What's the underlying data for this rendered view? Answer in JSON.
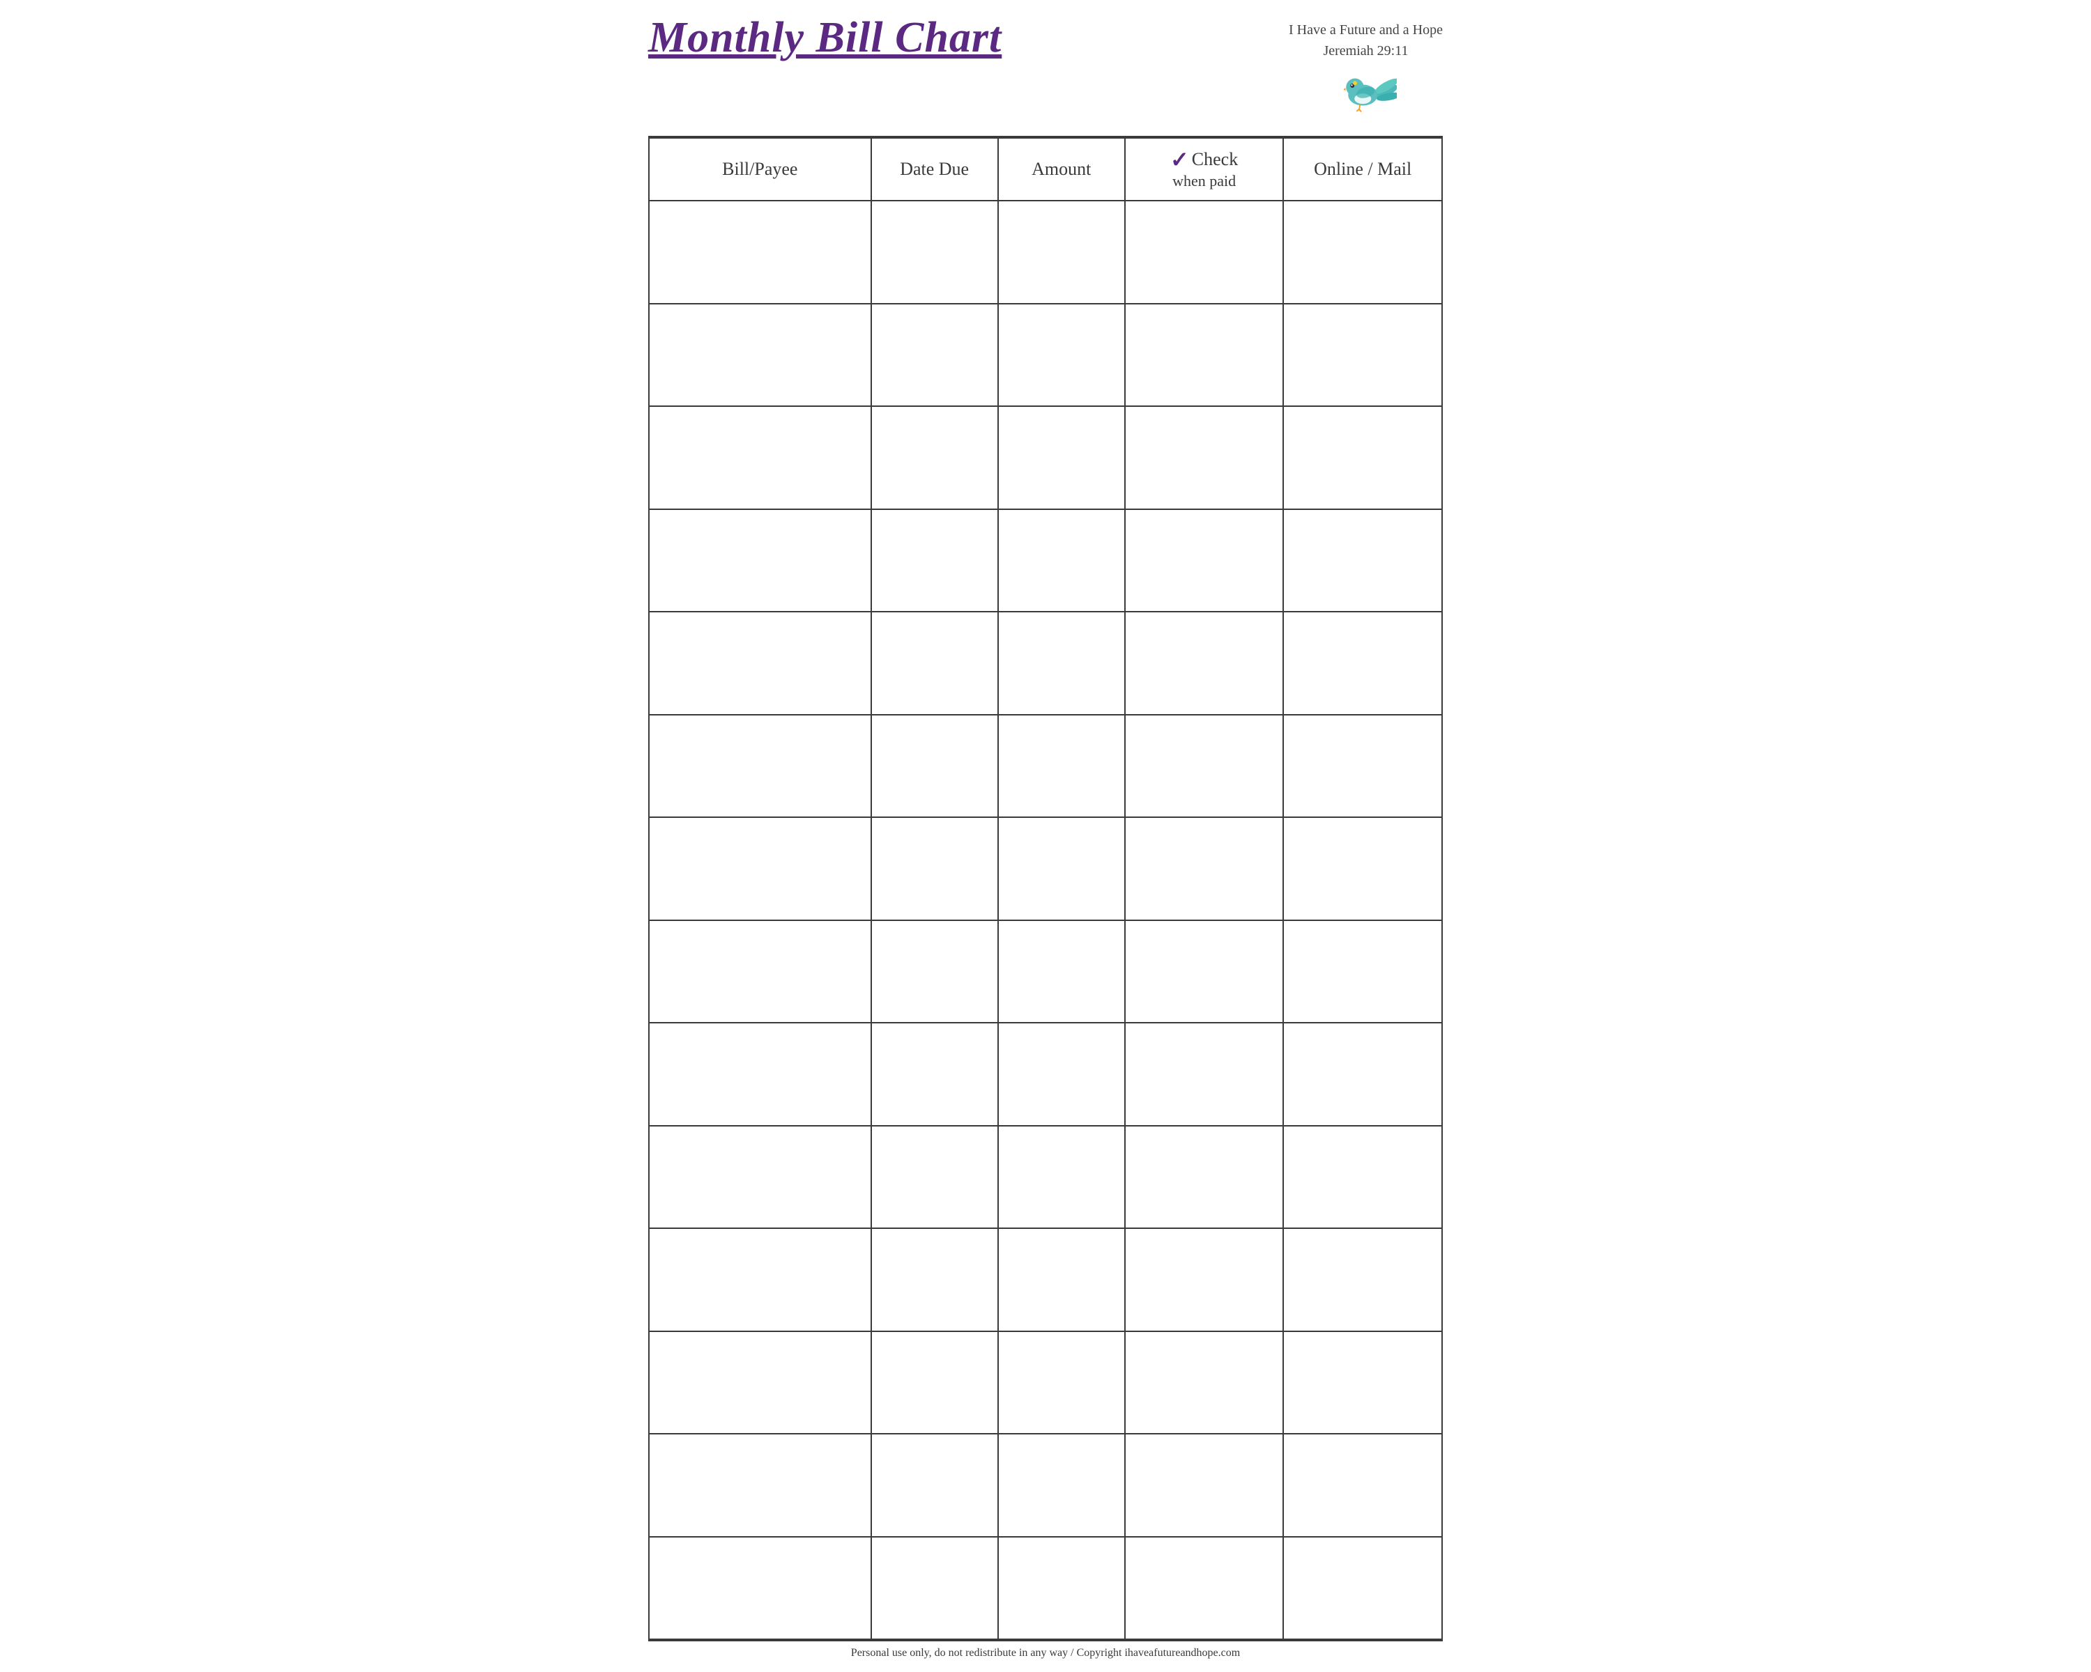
{
  "header": {
    "title": "Monthly Bill Chart",
    "scripture_line1": "I Have a Future and a Hope",
    "scripture_line2": "Jeremiah 29:11"
  },
  "table": {
    "columns": [
      {
        "key": "payee",
        "label": "Bill/Payee"
      },
      {
        "key": "date",
        "label": "Date Due"
      },
      {
        "key": "amount",
        "label": "Amount"
      },
      {
        "key": "check",
        "label": "Check",
        "sublabel": "when paid"
      },
      {
        "key": "online",
        "label": "Online / Mail"
      }
    ],
    "row_count": 14
  },
  "footer": {
    "text": "Personal use only, do not redistribute in any way / Copyright ihaveafutureandhope.com"
  },
  "colors": {
    "title": "#5b2882",
    "checkmark": "#5b2882",
    "border": "#3a3a3a",
    "text": "#3a3a3a"
  }
}
